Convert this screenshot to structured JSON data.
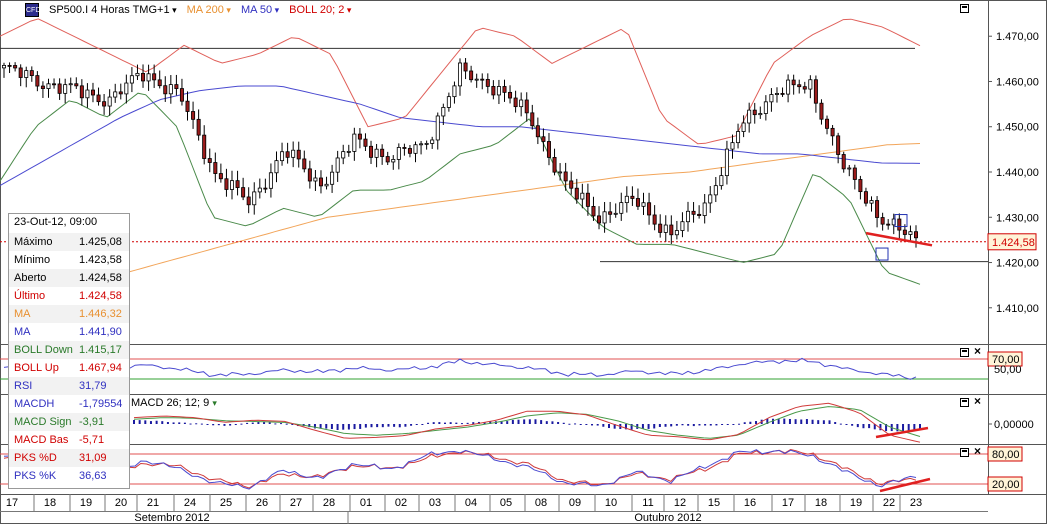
{
  "header": {
    "symbol": "SP500.I",
    "timeframe": "4 Horas TMG+1",
    "ma200_label": "MA 200",
    "ma50_label": "MA 50",
    "boll_label": "BOLL 20; 2",
    "logo_text": "CFD"
  },
  "colors": {
    "up_candle": "#ffffff",
    "down_candle": "#9b1c1c",
    "boll": "#e0605a",
    "boll_mid": "#4a8a4a",
    "ma200": "#f2a55a",
    "ma50": "#4a4ad0",
    "rsi": "#4a4ad0",
    "macd_hist": "#1a1aa0",
    "macd_signal": "#4a9a4a",
    "macd_base": "#d03a3a",
    "pks_d": "#d03a3a",
    "pks_k": "#4a4ad0",
    "price_line": "#d00000"
  },
  "infobox": {
    "title": "23-Out-12, 09:00",
    "rows": [
      {
        "label": "Máximo",
        "value": "1.425,08",
        "color": "#000000"
      },
      {
        "label": "Mínimo",
        "value": "1.423,58",
        "color": "#000000"
      },
      {
        "label": "Aberto",
        "value": "1.424,58",
        "color": "#000000"
      },
      {
        "label": "Último",
        "value": "1.424,58",
        "color": "#d00000"
      },
      {
        "label": "MA",
        "value": "1.446,32",
        "color": "#e89030"
      },
      {
        "label": "MA",
        "value": "1.441,90",
        "color": "#3030c0"
      },
      {
        "label": "BOLL Down",
        "value": "1.415,17",
        "color": "#2a7a2a"
      },
      {
        "label": "BOLL Up",
        "value": "1.467,94",
        "color": "#d00000"
      },
      {
        "label": "RSI",
        "value": "31,79",
        "color": "#3030c0"
      },
      {
        "label": "MACDH",
        "value": "-1,79554",
        "color": "#3030c0"
      },
      {
        "label": "MACD Sign",
        "value": "-3,91",
        "color": "#2a7a2a"
      },
      {
        "label": "MACD Bas",
        "value": "-5,71",
        "color": "#d00000"
      },
      {
        "label": "PKS %D",
        "value": "31,09",
        "color": "#d00000"
      },
      {
        "label": "PKS %K",
        "value": "36,63",
        "color": "#3030c0"
      }
    ]
  },
  "macd_label": "MACD 26; 12; 9",
  "chart_data": [
    {
      "type": "candlestick",
      "title": "SP500.I 4 Horas TMG+1",
      "y_ticks": [
        "1.470,00",
        "1.460,00",
        "1.450,00",
        "1.440,00",
        "1.430,00",
        "1.420,00",
        "1.410,00"
      ],
      "y_tick_values": [
        1470,
        1460,
        1450,
        1440,
        1430,
        1420,
        1410
      ],
      "ylim": [
        1402,
        1478
      ],
      "last_price_label": "1.424,58",
      "last_price": 1424.58,
      "x_days": [
        "17",
        "18",
        "19",
        "20",
        "21",
        "24",
        "25",
        "26",
        "27",
        "28",
        "01",
        "02",
        "03",
        "04",
        "05",
        "08",
        "09",
        "10",
        "11",
        "12",
        "15",
        "16",
        "17",
        "18",
        "19",
        "22",
        "23"
      ],
      "x_months": [
        "Setembro 2012",
        "Outubro 2012"
      ],
      "day_close_trend": [
        1463,
        1460,
        1458,
        1456,
        1462,
        1457,
        1440,
        1433,
        1445,
        1437,
        1447,
        1443,
        1446,
        1462,
        1459,
        1452,
        1437,
        1430,
        1434,
        1426,
        1433,
        1450,
        1458,
        1459,
        1440,
        1430,
        1424.6
      ],
      "series": [
        {
          "name": "MA 200",
          "values": [
            1418,
            1420,
            1422,
            1424,
            1426,
            1428,
            1430,
            1431,
            1432,
            1433,
            1434,
            1435,
            1436,
            1437,
            1438,
            1439,
            1439.5,
            1440,
            1441,
            1442,
            1443,
            1444,
            1445,
            1446,
            1446.3
          ]
        },
        {
          "name": "MA 50",
          "values": [
            1437,
            1442,
            1447,
            1452,
            1456,
            1458,
            1459,
            1459,
            1457,
            1455,
            1452,
            1451,
            1450,
            1450,
            1449,
            1448,
            1447,
            1446,
            1445,
            1444,
            1444,
            1443,
            1442,
            1441.9
          ]
        },
        {
          "name": "BOLL Up",
          "values": [
            1470,
            1474,
            1470,
            1466,
            1462,
            1468,
            1464,
            1466,
            1470,
            1466,
            1450,
            1452,
            1462,
            1472,
            1470,
            1464,
            1468,
            1472,
            1452,
            1446,
            1448,
            1464,
            1470,
            1474,
            1472,
            1467.9
          ]
        },
        {
          "name": "BOLL Down",
          "values": [
            1438,
            1450,
            1456,
            1452,
            1458,
            1450,
            1430,
            1428,
            1432,
            1430,
            1436,
            1436,
            1438,
            1444,
            1446,
            1452,
            1436,
            1428,
            1424,
            1424,
            1422,
            1420,
            1422,
            1440,
            1434,
            1418,
            1415.2
          ]
        }
      ],
      "annotations": [
        "Bearish line",
        "Bullish line"
      ]
    },
    {
      "type": "line",
      "name": "RSI",
      "y_ticks": [
        "70,00",
        "50,00"
      ],
      "levels": [
        70,
        30
      ],
      "values": [
        52,
        55,
        48,
        50,
        58,
        50,
        38,
        40,
        48,
        44,
        52,
        48,
        52,
        66,
        58,
        52,
        40,
        38,
        46,
        40,
        46,
        60,
        66,
        66,
        50,
        40,
        31.8
      ]
    },
    {
      "type": "bar",
      "name": "MACD 26; 12; 9",
      "y_ticks": [
        "0,00000"
      ],
      "histogram": [
        1.2,
        0.8,
        0.2,
        -0.6,
        0.6,
        0.2,
        -1.4,
        -1.8,
        -1.0,
        -0.8,
        0.6,
        0.4,
        0.8,
        1.6,
        0.6,
        -0.2,
        -1.6,
        -1.6,
        -0.4,
        -0.6,
        0.2,
        1.6,
        1.6,
        1.0,
        -1.0,
        -2.4,
        -1.8
      ],
      "signal": [
        1.5,
        2.0,
        1.8,
        1.0,
        0.8,
        0.5,
        -1.0,
        -3.0,
        -3.5,
        -3.0,
        -2.0,
        -1.0,
        0.5,
        2.5,
        3.5,
        3.0,
        1.0,
        -2.0,
        -3.5,
        -4.5,
        -3.5,
        0.5,
        4.0,
        5.5,
        4.5,
        -1.0,
        -3.9
      ],
      "base": [
        2.0,
        2.5,
        2.0,
        0.5,
        1.2,
        0.8,
        -2.0,
        -4.5,
        -4.2,
        -3.6,
        -1.5,
        -0.5,
        1.2,
        4.0,
        4.0,
        2.8,
        -0.5,
        -3.5,
        -4.0,
        -5.0,
        -3.3,
        2.0,
        5.5,
        6.5,
        3.5,
        -3.5,
        -5.7
      ]
    },
    {
      "type": "line",
      "name": "PKS",
      "y_ticks": [
        "80,00",
        "20,00"
      ],
      "levels": [
        80,
        20
      ],
      "pks_d": [
        70,
        74,
        62,
        40,
        62,
        55,
        28,
        16,
        40,
        34,
        58,
        50,
        70,
        86,
        74,
        58,
        26,
        18,
        40,
        30,
        50,
        80,
        86,
        82,
        50,
        20,
        31.1
      ],
      "pks_k": [
        74,
        70,
        55,
        36,
        68,
        50,
        22,
        14,
        48,
        30,
        62,
        48,
        76,
        88,
        70,
        52,
        22,
        16,
        44,
        26,
        56,
        84,
        86,
        78,
        44,
        16,
        36.6
      ]
    }
  ]
}
